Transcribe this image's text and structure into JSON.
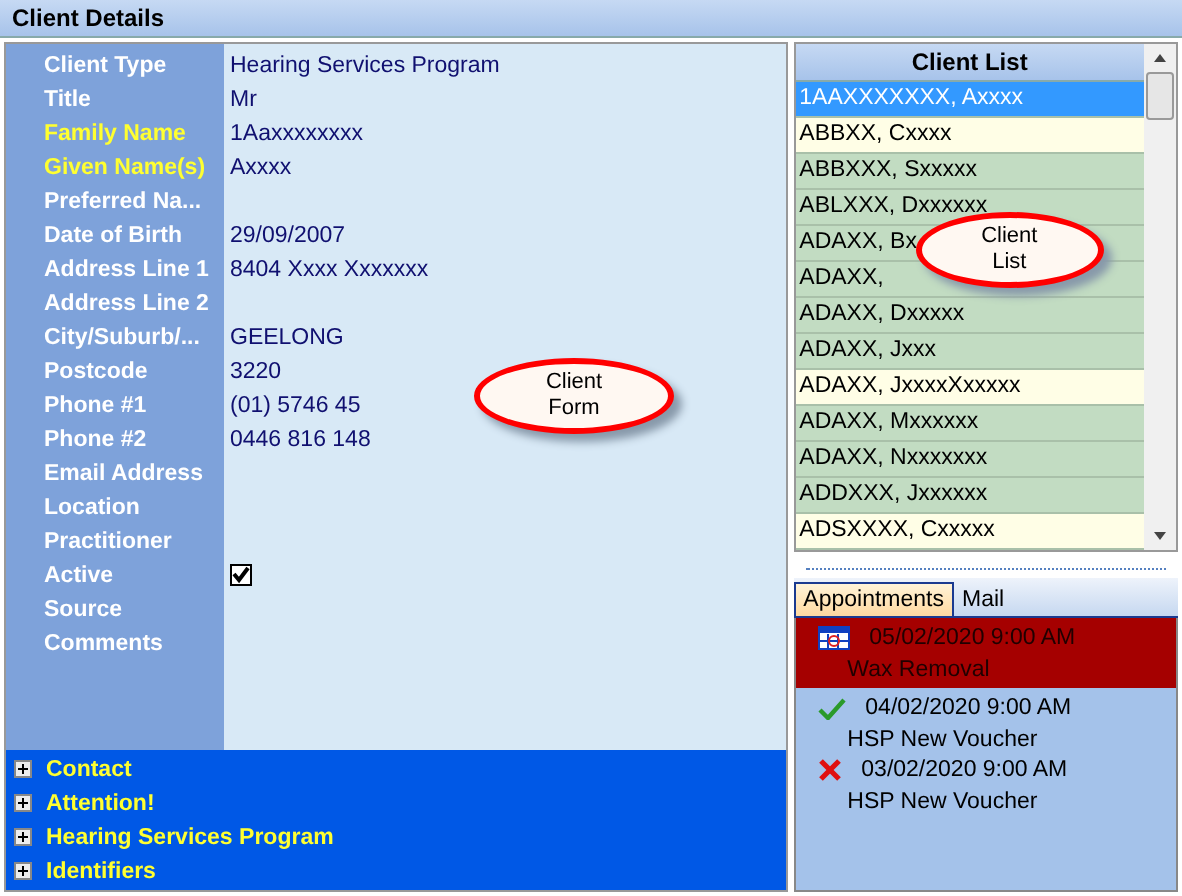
{
  "header": {
    "title": "Client Details"
  },
  "form": {
    "fields": [
      {
        "label": "Client Type",
        "value": "Hearing Services Program",
        "required": false,
        "kind": "text"
      },
      {
        "label": "Title",
        "value": "Mr",
        "required": false,
        "kind": "text"
      },
      {
        "label": "Family Name",
        "value": "1Aaxxxxxxxx",
        "required": true,
        "kind": "text"
      },
      {
        "label": "Given Name(s)",
        "value": "Axxxx",
        "required": true,
        "kind": "text"
      },
      {
        "label": "Preferred Na...",
        "required": false,
        "kind": "text"
      },
      {
        "label": "Date of Birth",
        "value": "29/09/2007",
        "required": false,
        "kind": "text"
      },
      {
        "label": "Address Line 1",
        "value": "8404 Xxxx Xxxxxxx",
        "required": false,
        "kind": "text"
      },
      {
        "label": "Address Line 2",
        "required": false,
        "kind": "text"
      },
      {
        "label": "City/Suburb/...",
        "value": "GEELONG",
        "required": false,
        "kind": "text"
      },
      {
        "label": "Postcode",
        "value": "3220",
        "required": false,
        "kind": "text"
      },
      {
        "label": "Phone #1",
        "value": "(01) 5746 45",
        "required": false,
        "kind": "text"
      },
      {
        "label": "Phone #2",
        "value": "0446 816 148",
        "required": false,
        "kind": "text"
      },
      {
        "label": "Email Address",
        "required": false,
        "kind": "text"
      },
      {
        "label": "Location",
        "required": false,
        "kind": "text"
      },
      {
        "label": "Practitioner",
        "required": false,
        "kind": "text"
      },
      {
        "label": "Active",
        "checked": true,
        "required": false,
        "kind": "checkbox"
      },
      {
        "label": "Source",
        "required": false,
        "kind": "text"
      },
      {
        "label": "Comments",
        "required": false,
        "kind": "text"
      }
    ],
    "callout": "Client\nForm"
  },
  "sections": [
    {
      "label": "Contact",
      "expanded": false
    },
    {
      "label": "Attention!",
      "expanded": false
    },
    {
      "label": "Hearing Services Program",
      "expanded": false
    },
    {
      "label": "Identifiers",
      "expanded": false
    }
  ],
  "client_list": {
    "title": "Client List",
    "callout": "Client\nList",
    "rows": [
      {
        "name": "1AAXXXXXXX, Axxxx",
        "selected": true
      },
      {
        "name": "ABBXX, Cxxxx",
        "selected": false,
        "color": "#fffee6"
      },
      {
        "name": "ABBXXX, Sxxxxx",
        "selected": false,
        "color": "#c2dcc2"
      },
      {
        "name": "ABLXXX, Dxxxxxx",
        "selected": false,
        "color": "#c2dcc2"
      },
      {
        "name": "ADAXX, Bx",
        "selected": false,
        "color": "#c2dcc2"
      },
      {
        "name": "ADAXX,",
        "selected": false,
        "color": "#c2dcc2"
      },
      {
        "name": "ADAXX, Dxxxxx",
        "selected": false,
        "color": "#c2dcc2"
      },
      {
        "name": "ADAXX, Jxxx",
        "selected": false,
        "color": "#c2dcc2"
      },
      {
        "name": "ADAXX, JxxxxXxxxxx",
        "selected": false,
        "color": "#fffee6"
      },
      {
        "name": "ADAXX, Mxxxxxx",
        "selected": false,
        "color": "#c2dcc2"
      },
      {
        "name": "ADAXX, Nxxxxxxx",
        "selected": false,
        "color": "#c2dcc2"
      },
      {
        "name": "ADDXXX, Jxxxxxx",
        "selected": false,
        "color": "#c2dcc2"
      },
      {
        "name": "ADSXXXX, Cxxxxx",
        "selected": false,
        "color": "#fffee6"
      }
    ]
  },
  "tabs": [
    {
      "label": "Appointments",
      "selected": true
    },
    {
      "label": "Mail",
      "selected": false
    }
  ],
  "appointments": [
    {
      "kind": "booked",
      "date": "05/02/2020 9:00 AM",
      "type": "Wax Removal",
      "selected": true
    },
    {
      "kind": "attended",
      "date": "04/02/2020 9:00 AM",
      "type": "HSP New Voucher",
      "selected": false
    },
    {
      "kind": "cancelled",
      "date": "03/02/2020 9:00 AM",
      "type": "HSP New Voucher",
      "selected": false
    }
  ]
}
